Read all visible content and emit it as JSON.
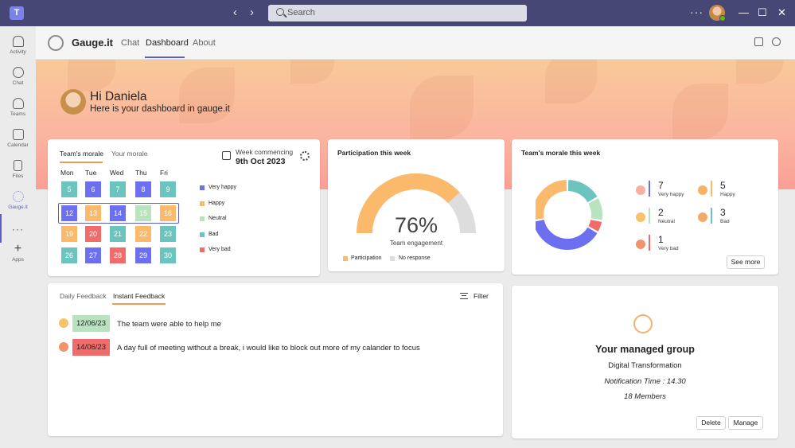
{
  "titlebar": {
    "search_placeholder": "Search",
    "back_arrow": "‹",
    "forward_arrow": "›",
    "more": "···",
    "minimize": "—",
    "maximize": "☐",
    "close": "✕"
  },
  "rail": {
    "items": [
      {
        "label": "Activity",
        "icon": "bell-icon"
      },
      {
        "label": "Chat",
        "icon": "chat-icon"
      },
      {
        "label": "Teams",
        "icon": "teams-icon"
      },
      {
        "label": "Calendar",
        "icon": "calendar-icon"
      },
      {
        "label": "Files",
        "icon": "file-icon"
      },
      {
        "label": "Gauge.it",
        "icon": "gauge-app-icon"
      },
      {
        "label": "···",
        "icon": "more-icon"
      },
      {
        "label": "Apps",
        "icon": "plus-icon"
      }
    ]
  },
  "app": {
    "name": "Gauge.it",
    "tabs": [
      "Chat",
      "Dashboard",
      "About"
    ],
    "active_tab": "Dashboard"
  },
  "hero": {
    "greeting": "Hi Daniela",
    "subtitle": "Here is your dashboard in gauge.it"
  },
  "morale": {
    "tabs": [
      "Team's morale",
      "Your morale"
    ],
    "week_label": "Week commencing",
    "week_date": "9th Oct 2023",
    "days": [
      "Mon",
      "Tue",
      "Wed",
      "Thu",
      "Fri"
    ],
    "rows": [
      [
        {
          "d": "5",
          "m": "Bad"
        },
        {
          "d": "6",
          "m": "Very happy"
        },
        {
          "d": "7",
          "m": "Bad"
        },
        {
          "d": "8",
          "m": "Very happy"
        },
        {
          "d": "9",
          "m": "Bad"
        }
      ],
      [
        {
          "d": "12",
          "m": "Very happy"
        },
        {
          "d": "13",
          "m": "Happy"
        },
        {
          "d": "14",
          "m": "Very happy"
        },
        {
          "d": "15",
          "m": "Neutral"
        },
        {
          "d": "16",
          "m": "Happy"
        }
      ],
      [
        {
          "d": "19",
          "m": "Happy"
        },
        {
          "d": "20",
          "m": "Very bad"
        },
        {
          "d": "21",
          "m": "Bad"
        },
        {
          "d": "22",
          "m": "Happy"
        },
        {
          "d": "23",
          "m": "Bad"
        }
      ],
      [
        {
          "d": "26",
          "m": "Bad"
        },
        {
          "d": "27",
          "m": "Very happy"
        },
        {
          "d": "28",
          "m": "Very bad"
        },
        {
          "d": "29",
          "m": "Very happy"
        },
        {
          "d": "30",
          "m": "Bad"
        }
      ]
    ],
    "legend": [
      {
        "label": "Very happy",
        "color": "#6b6ff0"
      },
      {
        "label": "Happy",
        "color": "#fbb96c"
      },
      {
        "label": "Neutral",
        "color": "#b9e2bf"
      },
      {
        "label": "Bad",
        "color": "#6cc4bf"
      },
      {
        "label": "Very bad",
        "color": "#f26b6b"
      }
    ]
  },
  "participation": {
    "title": "Participation this week",
    "percent_label": "76%",
    "value": 76,
    "caption": "Team engagement",
    "legend": [
      {
        "label": "Participation",
        "color": "#fbb96c"
      },
      {
        "label": "No response",
        "color": "#dddddd"
      }
    ]
  },
  "team_week": {
    "title": "Team's morale this week",
    "stats": [
      {
        "count": "7",
        "label": "Very happy",
        "color": "#6b6ff0",
        "value": 7
      },
      {
        "count": "5",
        "label": "Happy",
        "color": "#fbb96c",
        "value": 5
      },
      {
        "count": "2",
        "label": "Neutral",
        "color": "#b9e2bf",
        "value": 2
      },
      {
        "count": "3",
        "label": "Bad",
        "color": "#6cc4bf",
        "value": 3
      },
      {
        "count": "1",
        "label": "Very bad",
        "color": "#f26b6b",
        "value": 1
      }
    ],
    "see_more": "See more"
  },
  "feedback": {
    "tabs": [
      "Daily Feedback",
      "Instant Feedback"
    ],
    "active_tab": "Instant Feedback",
    "filter": "Filter",
    "items": [
      {
        "date": "12/06/23",
        "text": "The team were able to help me",
        "color": "#b9e2bf"
      },
      {
        "date": "14/06/23",
        "text": "A day full of meeting without a break, i would like to block out more of my calander to focus",
        "color": "#f26b6b"
      }
    ]
  },
  "group": {
    "title": "Your managed group",
    "name": "Digital Transformation",
    "notification": "Notification Time : 14.30",
    "members": "18 Members",
    "delete": "Delete",
    "manage": "Manage"
  }
}
